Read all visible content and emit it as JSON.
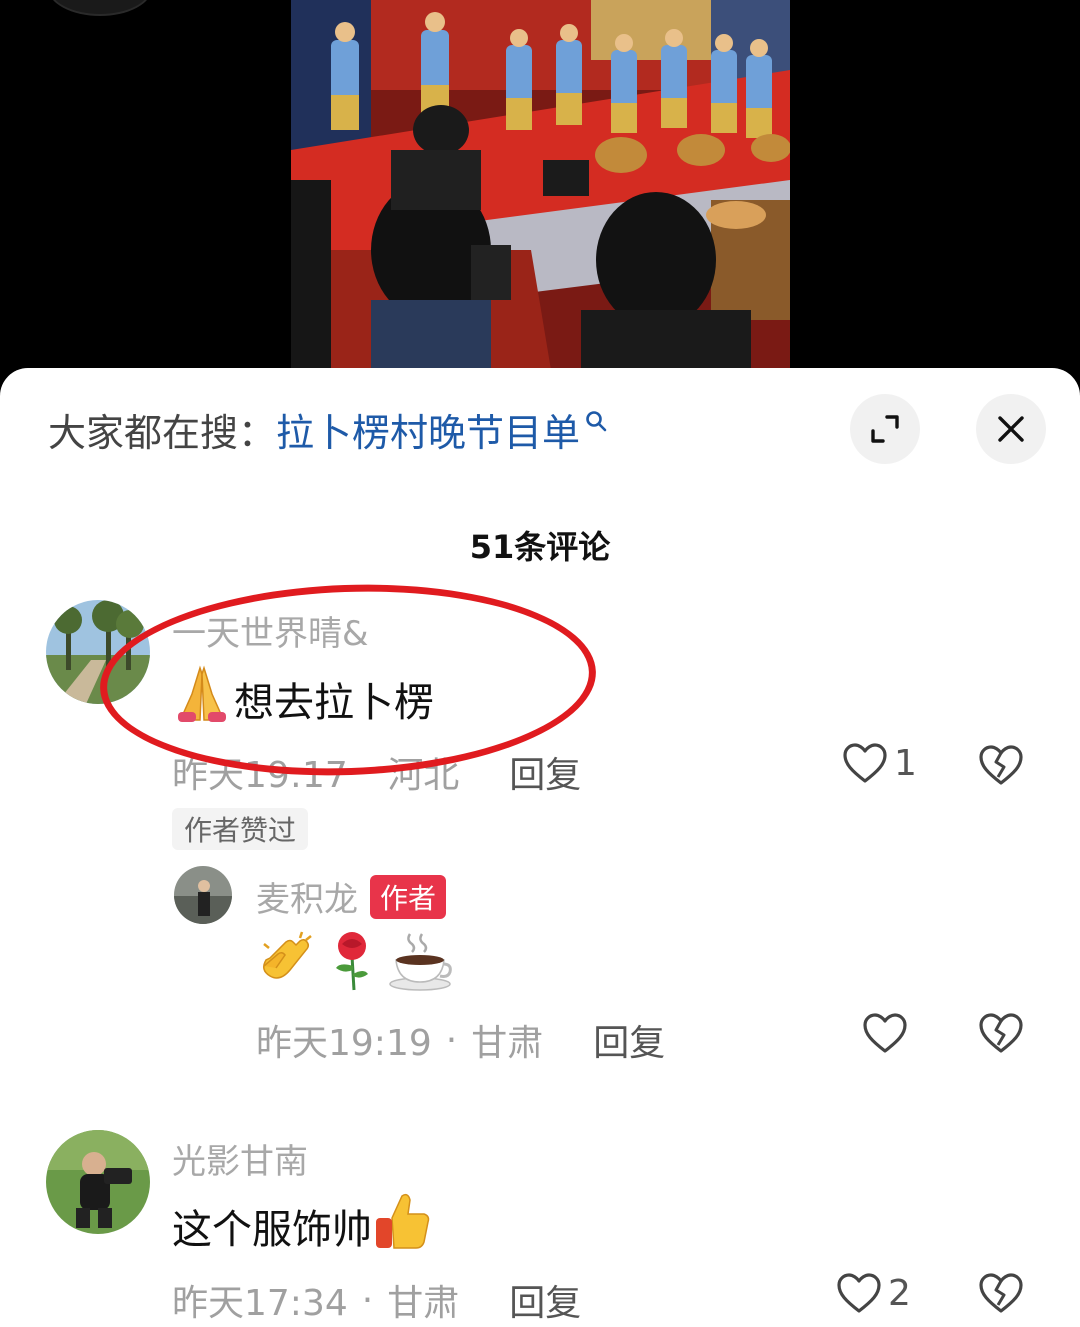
{
  "search": {
    "prefix": "大家都在搜：",
    "term": "拉卜楞村晚节目单"
  },
  "comment_count": "51条评论",
  "comments": [
    {
      "username": "一天世界晴&",
      "text": "想去拉卜楞",
      "time": "昨天19:17",
      "location": "河北",
      "reply_label": "回复",
      "likes": "1",
      "tag": "作者赞过",
      "replies": [
        {
          "username": "麦积龙",
          "badge": "作者",
          "time": "昨天19:19",
          "location": "甘肃",
          "reply_label": "回复"
        }
      ]
    },
    {
      "username": "光影甘南",
      "text": "这个服饰帅",
      "time": "昨天17:34",
      "location": "甘肃",
      "reply_label": "回复",
      "likes": "2"
    }
  ],
  "separator": "·",
  "colors": {
    "link": "#1e5aa8",
    "author_badge": "#e8344a",
    "annotation": "#e01b1f"
  },
  "icons": [
    "search-icon",
    "expand-icon",
    "close-icon",
    "heart-icon",
    "broken-heart-icon",
    "pray-emoji",
    "clap-emoji",
    "rose-emoji",
    "coffee-emoji",
    "thumbs-up-emoji"
  ]
}
